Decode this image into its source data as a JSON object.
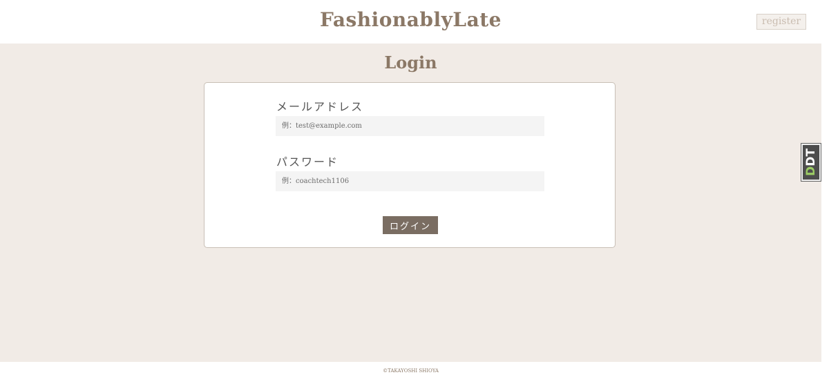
{
  "header": {
    "brand": "FashionablyLate",
    "register_label": "register"
  },
  "main": {
    "title": "Login",
    "email": {
      "label": "メールアドレス",
      "placeholder": "例：test@example.com",
      "value": ""
    },
    "password": {
      "label": "パスワード",
      "placeholder": "例：coachtech1106",
      "value": ""
    },
    "login_label": "ログイン"
  },
  "footer": {
    "copyright": "©TAKAYOSHI SHIOYA"
  },
  "side_widget": {
    "text_main": "D",
    "text_accent": "DT",
    "icon": "dt-badge-icon"
  },
  "colors": {
    "brand": "#8b7866",
    "background": "#f1ebe6",
    "button": "#7a6d62",
    "accent": "#9ccc65"
  }
}
